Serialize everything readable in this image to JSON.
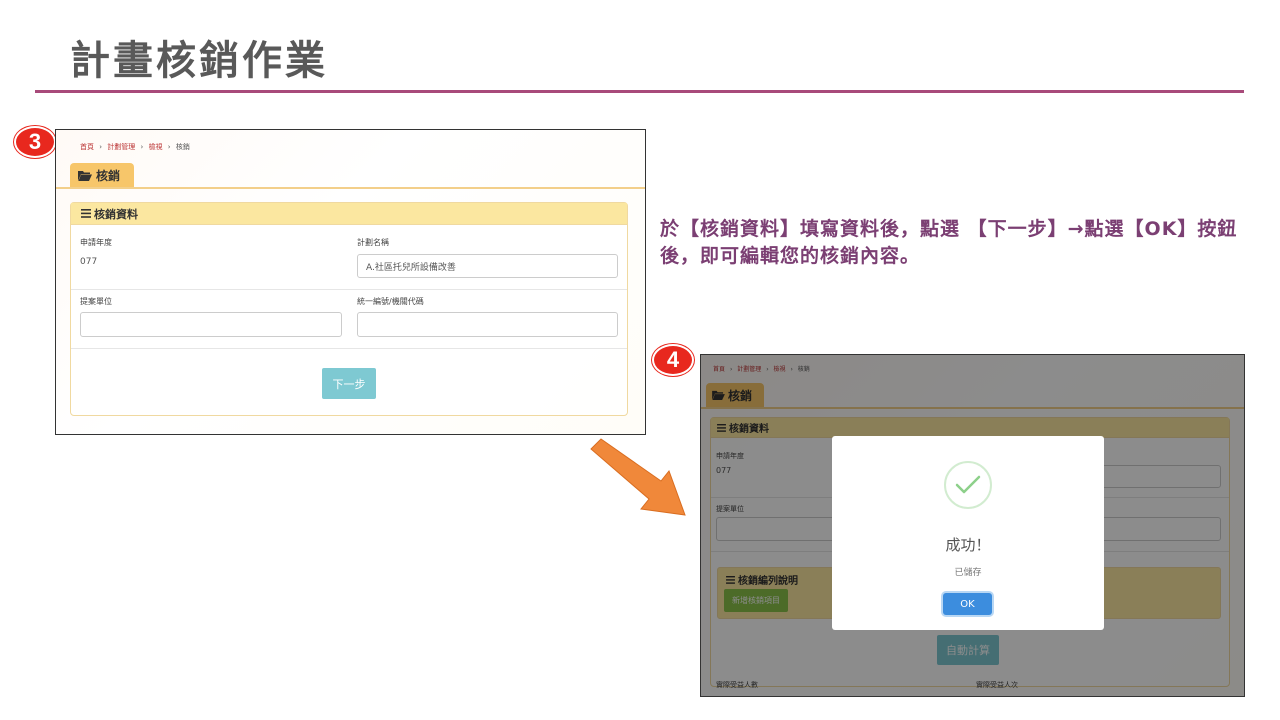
{
  "slide": {
    "title": "計畫核銷作業",
    "instruction": "於【核銷資料】填寫資料後，點選 【下一步】→點選【OK】按鈕後，即可編輯您的核銷內容。"
  },
  "steps": {
    "step3": "3",
    "step4": "4"
  },
  "breadcrumb": {
    "home": "首頁",
    "manage": "計劃管理",
    "view": "檢視",
    "current": "核銷",
    "separator": "›"
  },
  "form": {
    "tab_label": "核銷",
    "panel_title": "核銷資料",
    "apply_year_label": "申請年度",
    "apply_year_value": "077",
    "plan_name_label": "計劃名稱",
    "plan_name_value": "A.社區托兒所設備改善",
    "proposer_label": "提案單位",
    "proposer_value": "",
    "tax_id_label": "統一編號/機關代碼",
    "tax_id_value": "",
    "next_button": "下一步"
  },
  "shot4": {
    "list_title": "核銷編列說明",
    "add_item_button": "新增核銷項目",
    "auto_calc_button": "自動計算",
    "actual_people_label": "實際受益人數",
    "actual_times_label": "實際受益人次"
  },
  "modal": {
    "title": "成功！",
    "subtitle": "已儲存",
    "ok_button": "OK"
  },
  "colors": {
    "title_rule": "#a84a7a",
    "instruction_text": "#7b3f73",
    "badge": "#e8281e",
    "tab": "#f7c66a",
    "panel_head": "#fbe7a0",
    "next_button": "#7ec9d2",
    "ok_button": "#3c8dde",
    "add_button": "#8bc34a",
    "arrow": "#f0883a"
  },
  "icons": {
    "folder": "folder-open-icon",
    "list": "list-icon",
    "check": "check-icon",
    "arrow": "arrow-right-down-icon"
  }
}
